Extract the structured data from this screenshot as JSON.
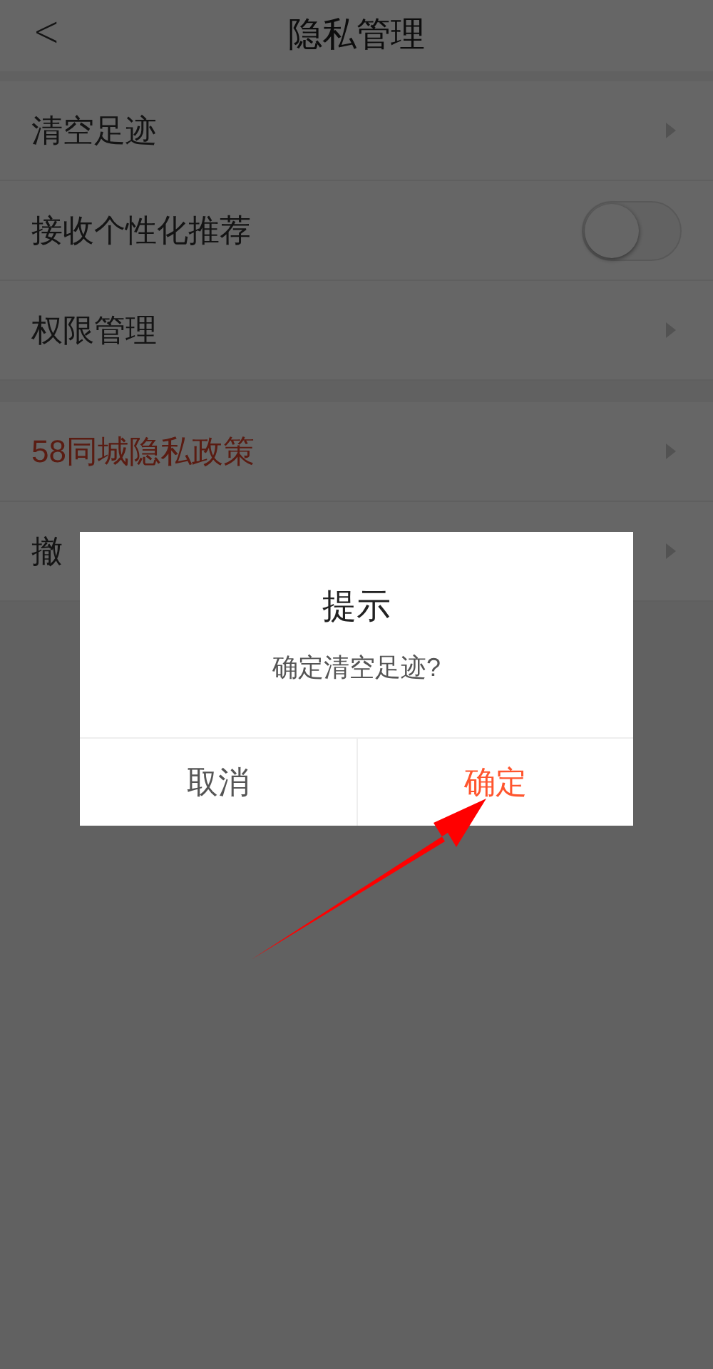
{
  "header": {
    "back": "<",
    "title": "隐私管理"
  },
  "sections": [
    {
      "rows": [
        {
          "kind": "link",
          "label": "清空足迹",
          "accent": false
        },
        {
          "kind": "toggle",
          "label": "接收个性化推荐",
          "accent": false,
          "on": false
        },
        {
          "kind": "link",
          "label": "权限管理",
          "accent": false
        }
      ]
    },
    {
      "rows": [
        {
          "kind": "link",
          "label": "58同城隐私政策",
          "accent": true
        },
        {
          "kind": "link",
          "label": "撤",
          "accent": false
        }
      ]
    }
  ],
  "dialog": {
    "title": "提示",
    "message": "确定清空足迹?",
    "buttons": [
      {
        "label": "取消",
        "primary": false
      },
      {
        "label": "确定",
        "primary": true
      }
    ]
  }
}
